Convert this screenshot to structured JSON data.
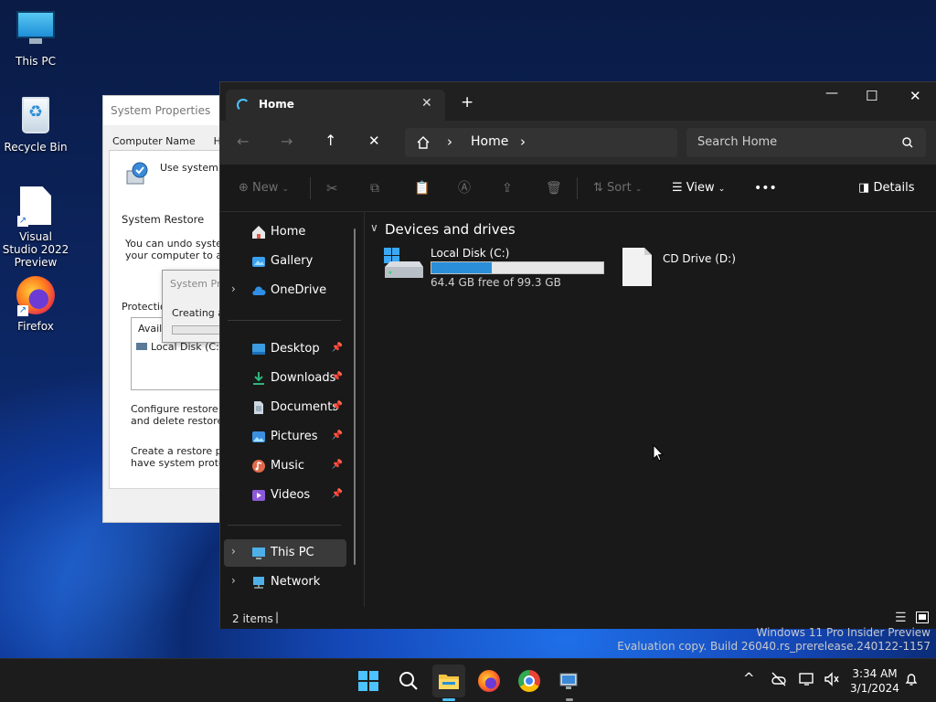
{
  "desktop": {
    "icons": [
      {
        "label": "This PC",
        "icon": "monitor-icon"
      },
      {
        "label": "Recycle Bin",
        "icon": "recycle-bin-icon"
      },
      {
        "label": "Visual Studio 2022 Preview",
        "icon": "file-shortcut-icon"
      },
      {
        "label": "Firefox",
        "icon": "firefox-icon"
      }
    ],
    "watermark": {
      "line1": "Windows 11 Pro Insider Preview",
      "line2": "Evaluation copy. Build 26040.rs_prerelease.240122-1157"
    }
  },
  "system_properties": {
    "title": "System Properties",
    "tabs": [
      "Computer Name",
      "Hardw"
    ],
    "use_text": "Use system pr",
    "section_restore": "System Restore",
    "undo_line1": "You can undo system",
    "undo_line2": "your computer to a pre",
    "protection_label": "Protection",
    "avail_label": "Availa",
    "local_disk": "Local Disk (C:)",
    "configure_line1": "Configure restore set",
    "configure_line2": "and delete restore po",
    "create_line1": "Create a restore poin",
    "create_line2": "have system protecti",
    "sub_dialog": {
      "title": "System Pr",
      "text": "Creating a"
    }
  },
  "explorer": {
    "tab_title": "Home",
    "new_tab_symbol": "+",
    "window_controls": {
      "minimize": "—",
      "maximize": "☐",
      "close": "✕"
    },
    "breadcrumb": {
      "current": "Home",
      "sep": "›"
    },
    "search_placeholder": "Search Home",
    "commands": {
      "new": "New",
      "sort": "Sort",
      "view": "View",
      "details": "Details",
      "more": "•••"
    },
    "sidebar": {
      "top": [
        {
          "label": "Home",
          "icon": "home-icon",
          "color": "#e6e6e6"
        },
        {
          "label": "Gallery",
          "icon": "gallery-icon",
          "color": "#3aa0f0"
        },
        {
          "label": "OneDrive",
          "icon": "onedrive-icon",
          "color": "#2f8fe6"
        }
      ],
      "pinned": [
        {
          "label": "Desktop",
          "icon": "desktop-folder-icon",
          "color": "#3b9be0"
        },
        {
          "label": "Downloads",
          "icon": "downloads-icon",
          "color": "#2fb67a"
        },
        {
          "label": "Documents",
          "icon": "documents-icon",
          "color": "#9bb3c9"
        },
        {
          "label": "Pictures",
          "icon": "pictures-icon",
          "color": "#3a8fe0"
        },
        {
          "label": "Music",
          "icon": "music-icon",
          "color": "#e06b4a"
        },
        {
          "label": "Videos",
          "icon": "videos-icon",
          "color": "#8c5ad8"
        }
      ],
      "bottom": [
        {
          "label": "This PC",
          "icon": "this-pc-icon",
          "color": "#4fb0e8"
        },
        {
          "label": "Network",
          "icon": "network-icon",
          "color": "#4fb0e8"
        }
      ],
      "pin_symbol": "📌"
    },
    "section": {
      "title": "Devices and drives",
      "chevron": "∨"
    },
    "drives": [
      {
        "name": "Local Disk (C:)",
        "free_text": "64.4 GB free of 99.3 GB",
        "used_fraction": 0.352
      },
      {
        "name": "CD Drive (D:)"
      }
    ],
    "status": {
      "items": "2 items",
      "cursor": "|"
    }
  },
  "taskbar": {
    "clock": {
      "time": "3:34 AM",
      "date": "3/1/2024"
    },
    "tray_chevron": "^",
    "colors": {
      "accent": "#4cc2ff",
      "bar": "#1c1c1c"
    }
  }
}
